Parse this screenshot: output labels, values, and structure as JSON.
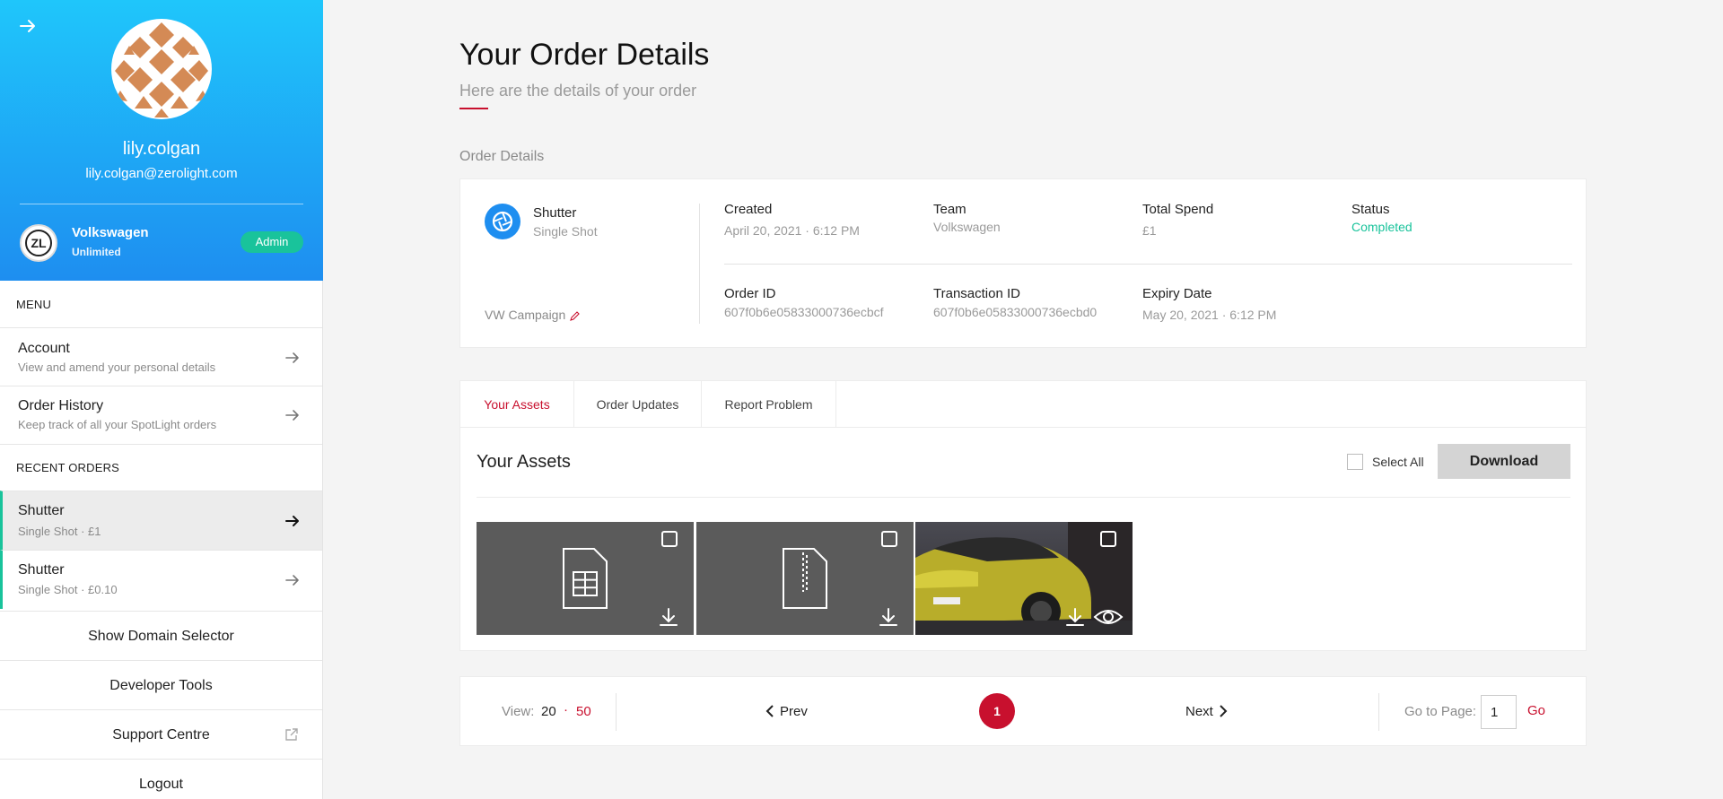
{
  "profile": {
    "username": "lily.colgan",
    "email": "lily.colgan@zerolight.com",
    "org_logo_text": "ZL",
    "org_name": "Volkswagen",
    "org_plan": "Unlimited",
    "role_badge": "Admin"
  },
  "menu": {
    "title": "MENU",
    "items": [
      {
        "title": "Account",
        "subtitle": "View and amend your personal details"
      },
      {
        "title": "Order History",
        "subtitle": "Keep track of all your SpotLight orders"
      }
    ]
  },
  "recent_orders": {
    "title": "RECENT ORDERS",
    "items": [
      {
        "title": "Shutter",
        "subtitle": "Single Shot · £1"
      },
      {
        "title": "Shutter",
        "subtitle": "Single Shot · £0.10"
      }
    ]
  },
  "sidebar_links": {
    "domain_selector": "Show Domain Selector",
    "developer_tools": "Developer Tools",
    "support_centre": "Support Centre",
    "logout": "Logout"
  },
  "page": {
    "title": "Your Order Details",
    "subtitle": "Here are the details of your order",
    "section_label": "Order Details"
  },
  "order": {
    "product_name": "Shutter",
    "product_type": "Single Shot",
    "campaign": "VW Campaign",
    "created_label": "Created",
    "created_value": "April 20, 2021 · 6:12 PM",
    "team_label": "Team",
    "team_value": "Volkswagen",
    "spend_label": "Total Spend",
    "spend_value": "£1",
    "status_label": "Status",
    "status_value": "Completed",
    "order_id_label": "Order ID",
    "order_id_value": "607f0b6e05833000736ecbcf",
    "transaction_id_label": "Transaction ID",
    "transaction_id_value": "607f0b6e05833000736ecbd0",
    "expiry_label": "Expiry Date",
    "expiry_value": "May 20, 2021 · 6:12 PM"
  },
  "tabs": [
    "Your Assets",
    "Order Updates",
    "Report Problem"
  ],
  "assets": {
    "heading": "Your Assets",
    "select_all": "Select All",
    "download": "Download",
    "items": [
      {
        "icon": "spreadsheet-file-icon"
      },
      {
        "icon": "zip-file-icon"
      },
      {
        "icon": "car-image-thumbnail"
      }
    ]
  },
  "pagination": {
    "view_label": "View:",
    "view_20": "20",
    "view_sep": "·",
    "view_50": "50",
    "prev": "Prev",
    "current_page": "1",
    "next": "Next",
    "goto_label": "Go to Page:",
    "goto_value": "1",
    "go": "Go"
  },
  "colors": {
    "accent_red": "#c8102e",
    "green": "#19c39b",
    "gradient_top": "#1fc6fb",
    "gradient_bottom": "#1e8ef0"
  }
}
